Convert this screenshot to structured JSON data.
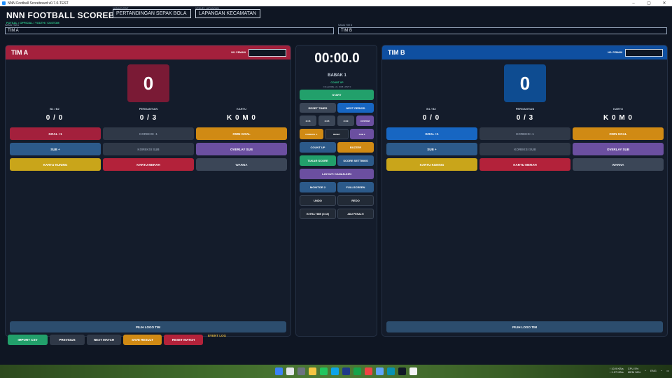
{
  "window": {
    "title": "NNN Football Scoreboard v0.7.0-TEST",
    "controls": [
      "–",
      "▢",
      "✕"
    ]
  },
  "header": {
    "title": "NNN FOOTBALL SCOREBOARD",
    "subtitle": "FUTSAL • OFFICIAL / YOUTH / CUSTOM",
    "event_label": "NAMA EVENT",
    "event_value": "PERTANDINGAN SEPAK BOLA",
    "venue_label": "VENUE / LAPANGAN",
    "venue_value": "LAPANGAN KECAMATAN",
    "team_a_label": "NAMA TIM A",
    "team_a_value": "TIM A",
    "team_b_label": "NAMA TIM B",
    "team_b_value": "TIM B"
  },
  "team_a": {
    "name": "TIM A",
    "player_no_label": "NO. PEMAIN",
    "score": "0",
    "stats": [
      {
        "label": "B1 / B2",
        "value": "0 / 0"
      },
      {
        "label": "PERGANTIAN",
        "value": "0 / 3"
      },
      {
        "label": "KARTU",
        "value": "K 0  M 0"
      }
    ],
    "buttons": {
      "goal": "GOAL +1",
      "koreksi": "KOREKSI -1",
      "own_goal": "OWN GOAL",
      "sub": "SUB +",
      "koreksi_sub": "KOREKSI SUB",
      "overlay_sub": "OVERLAY SUB",
      "kartu_kuning": "KARTU KUNING",
      "kartu_merah": "KARTU MERAH",
      "warna": "WARNA"
    },
    "logo_button": "PILIH LOGO TIM"
  },
  "team_b": {
    "name": "TIM B",
    "player_no_label": "NO. PEMAIN",
    "score": "0",
    "stats": [
      {
        "label": "B1 / B2",
        "value": "0 / 0"
      },
      {
        "label": "PERGANTIAN",
        "value": "0 / 3"
      },
      {
        "label": "KARTU",
        "value": "K 0  M 0"
      }
    ],
    "buttons": {
      "goal": "GOAL +1",
      "koreksi": "KOREKSI -1",
      "own_goal": "OWN GOAL",
      "sub": "SUB +",
      "koreksi_sub": "KOREKSI SUB",
      "overlay_sub": "OVERLAY SUB",
      "kartu_kuning": "KARTU KUNING",
      "kartu_merah": "KARTU MERAH",
      "warna": "WARNA"
    },
    "logo_button": "PILIH LOGO TIM"
  },
  "center": {
    "timer": "00:00.0",
    "period": "BABAK 1",
    "mode": "COUNT UP",
    "hint": "Ctrl+HOME +0 • SUB LOST 0",
    "start": "START",
    "reset_timer": "RESET TIMER",
    "next_period": "NEXT PERIOD",
    "presets": [
      "2×45",
      "2×35",
      "2×30",
      "CUSTOM"
    ],
    "adj_minus": "KOREKSI -1",
    "adj_mid": "RESET",
    "adj_plus": "SUB 2",
    "count_up": "COUNT UP",
    "buzzer": "BUZZER",
    "tukar_score": "TUKAR SCORE",
    "score_settings": "SCORE SETTINGS",
    "layout": "LAYOUT: KANAN-KIRI",
    "monitor": "MONITOR 2",
    "fullscreen": "FULLSCREEN",
    "undo": "UNDO",
    "redo": "REDO",
    "extra_time": "EXTRA TIME (2×15)",
    "adu_penalti": "ADU PENALTI"
  },
  "bottom": {
    "import_csv": "IMPORT CSV",
    "previous": "PREVIOUS",
    "next_match": "NEXT MATCH",
    "save_result": "SAVE RESULT",
    "reset_match": "RESET MATCH",
    "event_log": "EVENT LOG"
  },
  "taskbar": {
    "tray_net_up": "↑ 10.9 KB/s",
    "tray_net_down": "↓ 1.27 KB/s",
    "tray_cpu": "CPU  5%",
    "tray_mem": "MEM  36%",
    "tray_lang": "ENG"
  },
  "colors": {
    "team_a": "#a3203c",
    "team_b": "#0f4fa0",
    "accent_green": "#22a06b"
  }
}
